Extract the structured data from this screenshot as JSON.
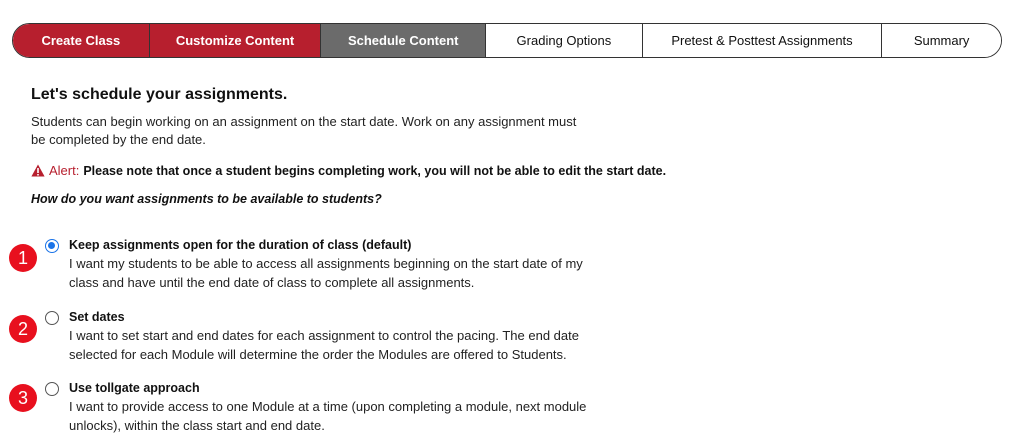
{
  "stepper": {
    "steps": [
      {
        "label": "Create Class",
        "state": "done"
      },
      {
        "label": "Customize Content",
        "state": "done"
      },
      {
        "label": "Schedule Content",
        "state": "active"
      },
      {
        "label": "Grading Options",
        "state": "todo"
      },
      {
        "label": "Pretest & Posttest Assignments",
        "state": "todo"
      },
      {
        "label": "Summary",
        "state": "todo"
      }
    ]
  },
  "main": {
    "heading": "Let's schedule your assignments.",
    "intro": "Students can begin working on an assignment on the start date. Work on any assignment must be completed by the end date.",
    "alert": {
      "icon": "warning-triangle-icon",
      "label": "Alert:",
      "text": "Please note that once a student begins completing work, you will not be able to edit the start date."
    },
    "question": "How do you want assignments to be available to students?",
    "options": [
      {
        "marker": "1",
        "title": "Keep assignments open for the duration of class (default)",
        "description": "I want my students to be able to access all assignments beginning on the start date of my class and have until the end date of class to complete all assignments.",
        "selected": true
      },
      {
        "marker": "2",
        "title": "Set dates",
        "description": "I want to set start and end dates for each assignment to control the pacing. The end date selected for each Module will determine the order the Modules are offered to Students.",
        "selected": false
      },
      {
        "marker": "3",
        "title": "Use tollgate approach",
        "description": "I want to provide access to one Module at a time (upon completing a module, next module unlocks), within the class start and end date.",
        "selected": false
      }
    ]
  },
  "colors": {
    "brand_red": "#b71f2e",
    "active_gray": "#6b6b6b",
    "marker_red": "#e8101e",
    "radio_blue": "#1a73e8"
  }
}
